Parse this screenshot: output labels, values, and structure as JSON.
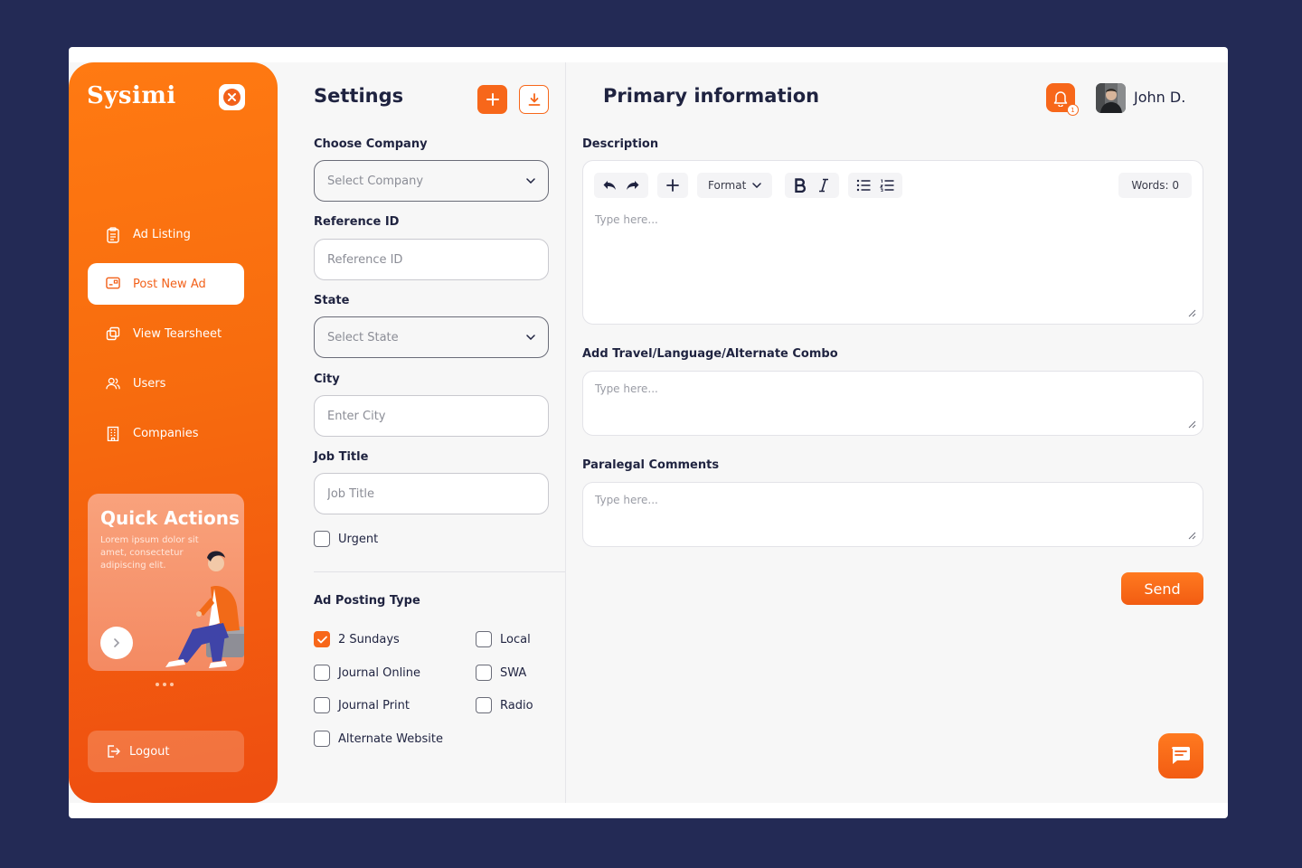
{
  "brand": {
    "name": "Sysimi",
    "accent": "#f7671a"
  },
  "sidebar": {
    "items": [
      {
        "label": "Ad Listing",
        "icon": "clipboard-icon"
      },
      {
        "label": "Post New Ad",
        "icon": "card-icon",
        "active": true
      },
      {
        "label": "View Tearsheet",
        "icon": "copy-icon"
      },
      {
        "label": "Users",
        "icon": "users-icon"
      },
      {
        "label": "Companies",
        "icon": "building-icon"
      }
    ],
    "quick_actions": {
      "title": "Quick Actions",
      "text": "Lorem ipsum dolor sit amet, consectetur adipiscing elit."
    },
    "logout_label": "Logout"
  },
  "settings": {
    "title": "Settings",
    "company": {
      "label": "Choose Company",
      "placeholder": "Select Company"
    },
    "reference": {
      "label": "Reference ID",
      "placeholder": "Reference ID"
    },
    "state": {
      "label": "State",
      "placeholder": "Select State"
    },
    "city": {
      "label": "City",
      "placeholder": "Enter City"
    },
    "job_title": {
      "label": "Job Title",
      "placeholder": "Job Title"
    },
    "urgent_label": "Urgent",
    "posting_type": {
      "label": "Ad Posting Type",
      "options": [
        {
          "label": "2 Sundays",
          "checked": true
        },
        {
          "label": "Local",
          "checked": false
        },
        {
          "label": "Journal Online",
          "checked": false
        },
        {
          "label": "SWA",
          "checked": false
        },
        {
          "label": "Journal Print",
          "checked": false
        },
        {
          "label": "Radio",
          "checked": false
        },
        {
          "label": "Alternate Website",
          "checked": false
        }
      ]
    }
  },
  "primary": {
    "title": "Primary information",
    "notification_count": "1",
    "user_name": "John D.",
    "description": {
      "label": "Description",
      "format_label": "Format",
      "words_label": "Words: 0",
      "placeholder": "Type here..."
    },
    "combo": {
      "label": "Add Travel/Language/Alternate Combo",
      "placeholder": "Type here..."
    },
    "comments": {
      "label": "Paralegal Comments",
      "placeholder": "Type here..."
    },
    "send_label": "Send"
  }
}
